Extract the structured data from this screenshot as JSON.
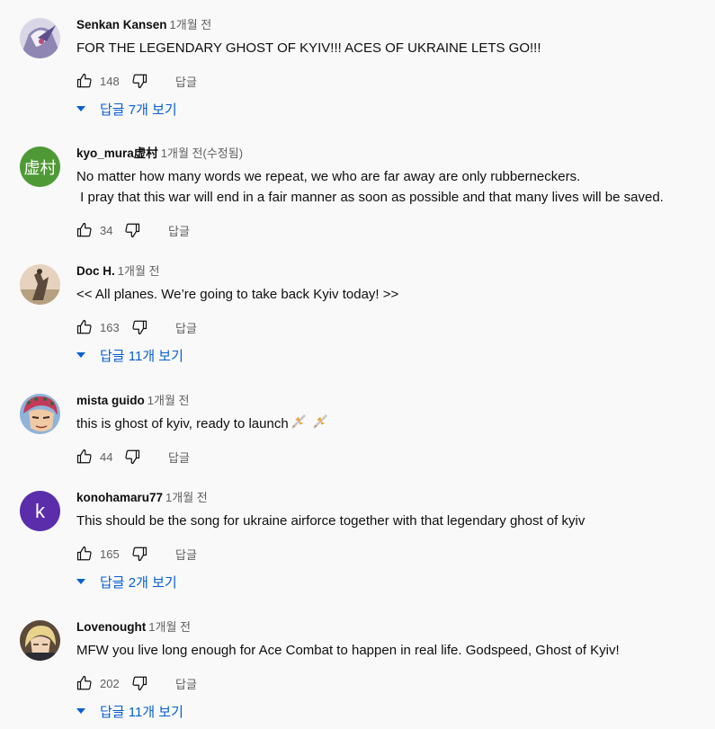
{
  "comments": [
    {
      "author": "Senkan Kansen",
      "time": "1개월 전",
      "text": "FOR THE LEGENDARY GHOST OF KYIV!!! ACES OF UKRAINE LETS GO!!!",
      "likes": "148",
      "reply_label": "답글",
      "replies_label": "답글 7개 보기"
    },
    {
      "author": "kyo_mura虚村",
      "time": "1개월 전(수정됨)",
      "text_line1": "No matter how many words we repeat, we who are far away are only rubberneckers.",
      "text_line2": " I pray that this war will end in a fair manner as soon as possible and that many lives will be saved.",
      "likes": "34",
      "reply_label": "답글",
      "avatar_text": "虚村",
      "avatar_color": "#4f9a36"
    },
    {
      "author": "Doc H.",
      "time": "1개월 전",
      "text": "<< All planes. We’re going to take back Kyiv today! >>",
      "likes": "163",
      "reply_label": "답글",
      "replies_label": "답글 11개 보기"
    },
    {
      "author": "mista guido",
      "time": "1개월 전",
      "text": "this is ghost of kyiv, ready to launch",
      "likes": "44",
      "reply_label": "답글"
    },
    {
      "author": "konohamaru77",
      "time": "1개월 전",
      "text": "This should be the song for ukraine airforce together with that legendary ghost of kyiv",
      "likes": "165",
      "reply_label": "답글",
      "replies_label": "답글 2개 보기",
      "avatar_text": "k",
      "avatar_color": "#5b2dab"
    },
    {
      "author": "Lovenought",
      "time": "1개월 전",
      "text": "MFW you live long enough for Ace Combat to happen in real life. Godspeed, Ghost of Kyiv!",
      "likes": "202",
      "reply_label": "답글",
      "replies_label": "답글 11개 보기"
    }
  ],
  "icons": {
    "like": "thumbs-up-icon",
    "dislike": "thumbs-down-icon",
    "expand": "caret-down-icon",
    "emoji": "airplane-emoji"
  },
  "colors": {
    "link": "#065fd4",
    "meta": "#606060",
    "background": "#f9f9f9"
  }
}
